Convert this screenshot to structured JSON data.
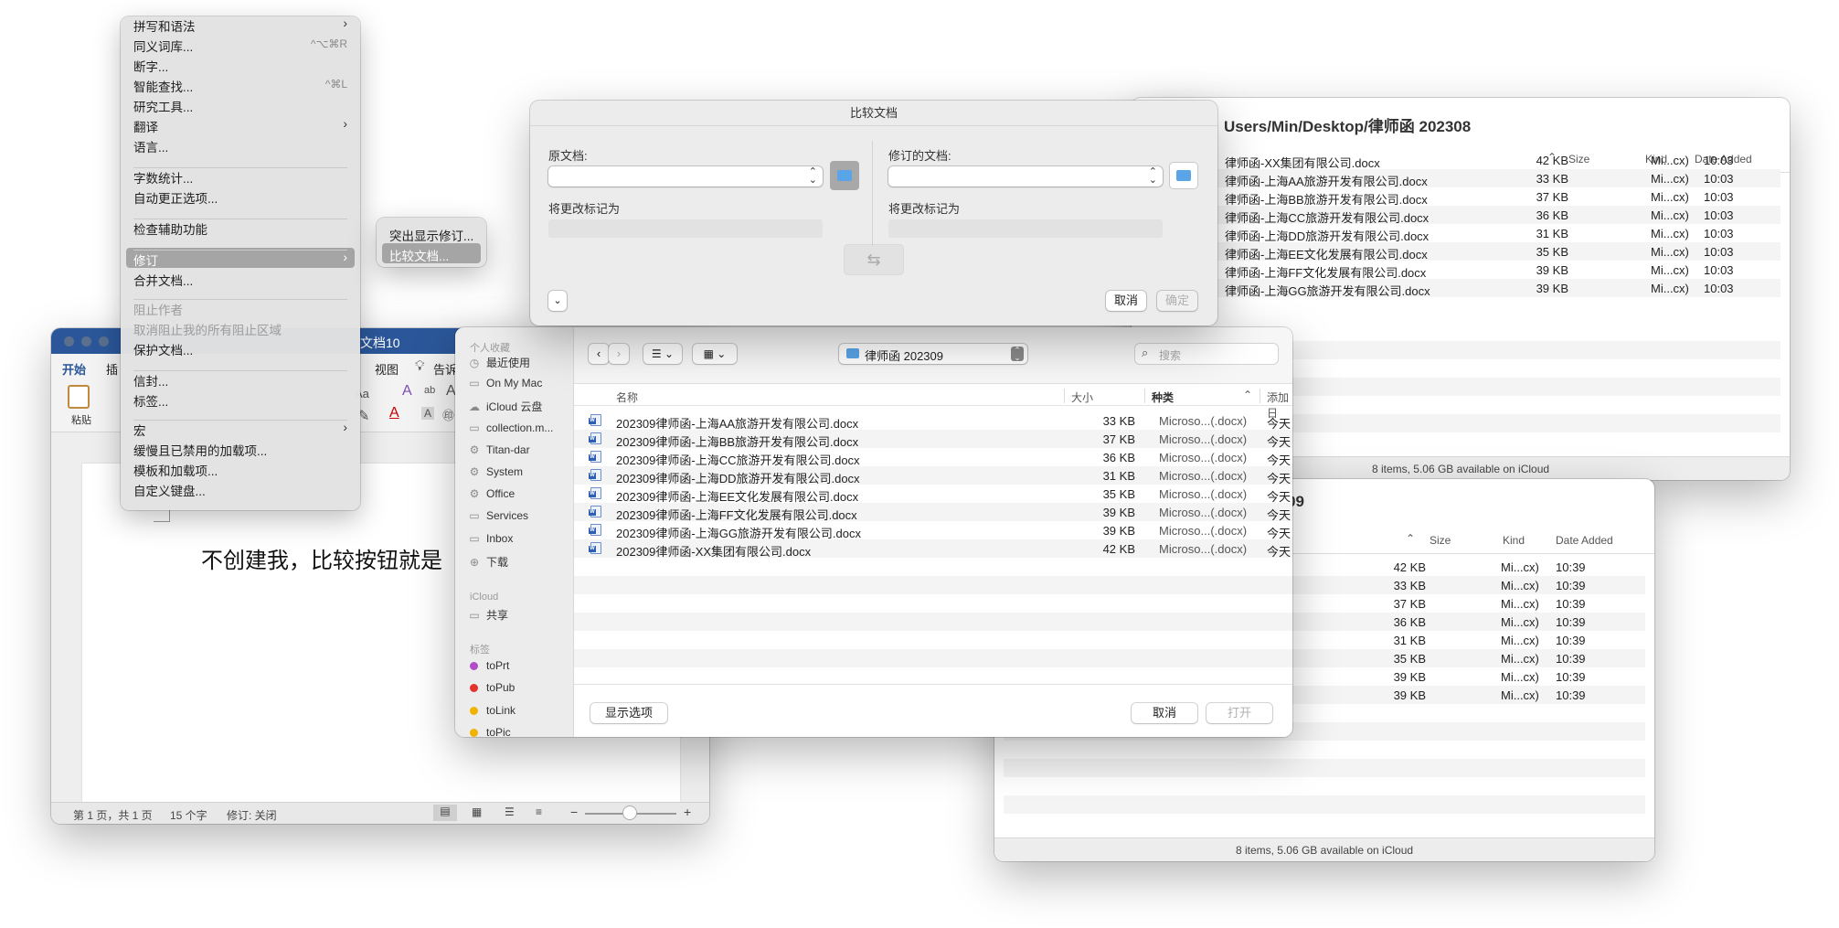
{
  "finder_back": {
    "title": "Users/Min/Desktop/律师函 202308",
    "columns": {
      "size": "Size",
      "kind": "Kind",
      "date": "Date Added"
    },
    "rows": [
      {
        "name": "律师函-XX集团有限公司.docx",
        "size": "42 KB",
        "kind": "Mi...cx)",
        "date": "10:03"
      },
      {
        "name": "律师函-上海AA旅游开发有限公司.docx",
        "size": "33 KB",
        "kind": "Mi...cx)",
        "date": "10:03"
      },
      {
        "name": "律师函-上海BB旅游开发有限公司.docx",
        "size": "37 KB",
        "kind": "Mi...cx)",
        "date": "10:03"
      },
      {
        "name": "律师函-上海CC旅游开发有限公司.docx",
        "size": "36 KB",
        "kind": "Mi...cx)",
        "date": "10:03"
      },
      {
        "name": "律师函-上海DD旅游开发有限公司.docx",
        "size": "31 KB",
        "kind": "Mi...cx)",
        "date": "10:03"
      },
      {
        "name": "律师函-上海EE文化发展有限公司.docx",
        "size": "35 KB",
        "kind": "Mi...cx)",
        "date": "10:03"
      },
      {
        "name": "律师函-上海FF文化发展有限公司.docx",
        "size": "39 KB",
        "kind": "Mi...cx)",
        "date": "10:03"
      },
      {
        "name": "律师函-上海GG旅游开发有限公司.docx",
        "size": "39 KB",
        "kind": "Mi...cx)",
        "date": "10:03"
      }
    ],
    "status": "8 items, 5.06 GB available on iCloud"
  },
  "finder_front": {
    "title": "09",
    "columns": {
      "size": "Size",
      "kind": "Kind",
      "date": "Date Added"
    },
    "rows": [
      {
        "size": "42 KB",
        "kind": "Mi...cx)",
        "date": "10:39"
      },
      {
        "size": "33 KB",
        "kind": "Mi...cx)",
        "date": "10:39"
      },
      {
        "size": "37 KB",
        "kind": "Mi...cx)",
        "date": "10:39"
      },
      {
        "size": "36 KB",
        "kind": "Mi...cx)",
        "date": "10:39"
      },
      {
        "size": "31 KB",
        "kind": "Mi...cx)",
        "date": "10:39"
      },
      {
        "size": "35 KB",
        "kind": "Mi...cx)",
        "date": "10:39"
      },
      {
        "size": "39 KB",
        "kind": "Mi...cx)",
        "date": "10:39"
      },
      {
        "size": "39 KB",
        "kind": "Mi...cx)",
        "date": "10:39"
      }
    ],
    "status": "8 items, 5.06 GB available on iCloud"
  },
  "word": {
    "title": "文档10",
    "tabs": {
      "home": "开始",
      "insert": "插",
      "view": "视图",
      "tell": "告诉"
    },
    "paste_label": "粘贴",
    "font_size_label": "Aa",
    "doc_text": "不创建我，比较按钮就是",
    "status": {
      "page": "第 1 页，共 1 页",
      "words": "15 个字",
      "track": "修订: 关闭"
    }
  },
  "context_menu": {
    "items": [
      {
        "label": "拼写和语法",
        "shortcut": "",
        "arrow": "›"
      },
      {
        "label": "同义词库...",
        "shortcut": "^⌥⌘R",
        "arrow": ""
      },
      {
        "label": "断字...",
        "shortcut": "",
        "arrow": ""
      },
      {
        "label": "智能查找...",
        "shortcut": "^⌘L",
        "arrow": ""
      },
      {
        "label": "研究工具...",
        "shortcut": "",
        "arrow": ""
      },
      {
        "label": "翻译",
        "shortcut": "",
        "arrow": "›"
      },
      {
        "label": "语言...",
        "shortcut": "",
        "arrow": ""
      },
      {
        "label": "字数统计...",
        "shortcut": "",
        "arrow": ""
      },
      {
        "label": "自动更正选项...",
        "shortcut": "",
        "arrow": ""
      },
      {
        "label": "检查辅助功能",
        "shortcut": "",
        "arrow": ""
      },
      {
        "label": "修订",
        "shortcut": "",
        "arrow": "›"
      },
      {
        "label": "合并文档...",
        "shortcut": "",
        "arrow": ""
      },
      {
        "label": "阻止作者",
        "shortcut": "",
        "arrow": ""
      },
      {
        "label": "取消阻止我的所有阻止区域",
        "shortcut": "",
        "arrow": ""
      },
      {
        "label": "保护文档...",
        "shortcut": "",
        "arrow": ""
      },
      {
        "label": "信封...",
        "shortcut": "",
        "arrow": ""
      },
      {
        "label": "标签...",
        "shortcut": "",
        "arrow": ""
      },
      {
        "label": "宏",
        "shortcut": "",
        "arrow": "›"
      },
      {
        "label": "缓慢且已禁用的加载项...",
        "shortcut": "",
        "arrow": ""
      },
      {
        "label": "模板和加载项...",
        "shortcut": "",
        "arrow": ""
      },
      {
        "label": "自定义键盘...",
        "shortcut": "",
        "arrow": ""
      }
    ]
  },
  "submenu": {
    "items": [
      {
        "label": "突出显示修订..."
      },
      {
        "label": "比较文档..."
      }
    ]
  },
  "compare_dialog": {
    "title": "比较文档",
    "original_label": "原文档:",
    "revised_label": "修订的文档:",
    "mark_label_left": "将更改标记为",
    "mark_label_right": "将更改标记为",
    "swap_icon": "⇆",
    "cancel": "取消",
    "ok": "确定"
  },
  "open_dialog": {
    "sidebar": {
      "favorites_header": "个人收藏",
      "favorites": [
        {
          "label": "最近使用",
          "icon": "clock-icon",
          "glyph": "◷"
        },
        {
          "label": "On My Mac",
          "icon": "folder-icon",
          "glyph": "▭"
        },
        {
          "label": "iCloud 云盘",
          "icon": "cloud-icon",
          "glyph": "☁"
        },
        {
          "label": "collection.m...",
          "icon": "folder-icon",
          "glyph": "▭"
        },
        {
          "label": "Titan-dar",
          "icon": "gear-icon",
          "glyph": "⚙"
        },
        {
          "label": "System",
          "icon": "gear-icon",
          "glyph": "⚙"
        },
        {
          "label": "Office",
          "icon": "gear-icon",
          "glyph": "⚙"
        },
        {
          "label": "Services",
          "icon": "folder-icon",
          "glyph": "▭"
        },
        {
          "label": "Inbox",
          "icon": "folder-icon",
          "glyph": "▭"
        },
        {
          "label": "下载",
          "icon": "download-icon",
          "glyph": "⊕"
        }
      ],
      "icloud_header": "iCloud",
      "icloud": [
        {
          "label": "共享",
          "icon": "shared-folder-icon",
          "glyph": "▭"
        }
      ],
      "tags_header": "标签",
      "tags": [
        {
          "label": "toPrt",
          "color": "#b04cc8"
        },
        {
          "label": "toPub",
          "color": "#e5322d"
        },
        {
          "label": "toLink",
          "color": "#f0b400"
        },
        {
          "label": "toPic",
          "color": "#f0b400"
        }
      ]
    },
    "location": "律师函 202309",
    "search_placeholder": "搜索",
    "columns": {
      "name": "名称",
      "size": "大小",
      "kind": "种类",
      "added": "添加日"
    },
    "files": [
      {
        "name": "202309律师函-上海AA旅游开发有限公司.docx",
        "size": "33 KB",
        "kind": "Microso...(.docx)",
        "added": "今天"
      },
      {
        "name": "202309律师函-上海BB旅游开发有限公司.docx",
        "size": "37 KB",
        "kind": "Microso...(.docx)",
        "added": "今天"
      },
      {
        "name": "202309律师函-上海CC旅游开发有限公司.docx",
        "size": "36 KB",
        "kind": "Microso...(.docx)",
        "added": "今天"
      },
      {
        "name": "202309律师函-上海DD旅游开发有限公司.docx",
        "size": "31 KB",
        "kind": "Microso...(.docx)",
        "added": "今天"
      },
      {
        "name": "202309律师函-上海EE文化发展有限公司.docx",
        "size": "35 KB",
        "kind": "Microso...(.docx)",
        "added": "今天"
      },
      {
        "name": "202309律师函-上海FF文化发展有限公司.docx",
        "size": "39 KB",
        "kind": "Microso...(.docx)",
        "added": "今天"
      },
      {
        "name": "202309律师函-上海GG旅游开发有限公司.docx",
        "size": "39 KB",
        "kind": "Microso...(.docx)",
        "added": "今天"
      },
      {
        "name": "202309律师函-XX集团有限公司.docx",
        "size": "42 KB",
        "kind": "Microso...(.docx)",
        "added": "今天"
      }
    ],
    "show_options": "显示选项",
    "cancel": "取消",
    "open": "打开"
  }
}
